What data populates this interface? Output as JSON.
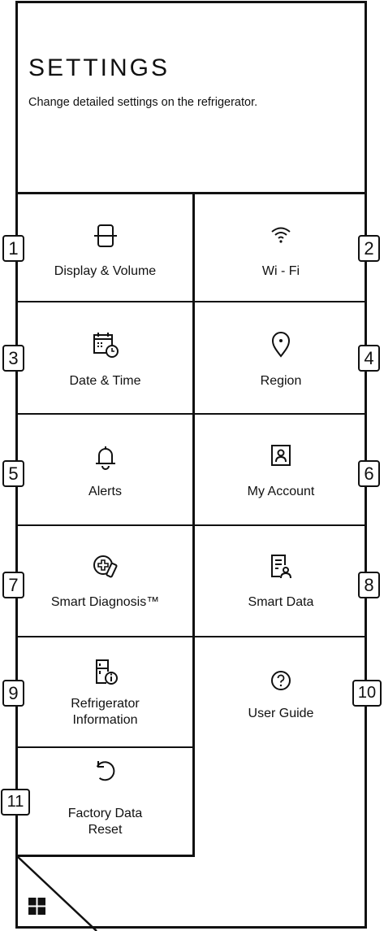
{
  "header": {
    "title": "SETTINGS",
    "subtitle": "Change detailed settings on the refrigerator."
  },
  "tiles": [
    {
      "label": "Display & Volume",
      "icon": "display-volume-icon",
      "badge": "1"
    },
    {
      "label": "Wi - Fi",
      "icon": "wifi-icon",
      "badge": "2"
    },
    {
      "label": "Date & Time",
      "icon": "calendar-clock-icon",
      "badge": "3"
    },
    {
      "label": "Region",
      "icon": "location-pin-icon",
      "badge": "4"
    },
    {
      "label": "Alerts",
      "icon": "bell-icon",
      "badge": "5"
    },
    {
      "label": "My Account",
      "icon": "account-icon",
      "badge": "6"
    },
    {
      "label": "Smart Diagnosis™",
      "icon": "smart-diagnosis-icon",
      "badge": "7"
    },
    {
      "label": "Smart Data",
      "icon": "smart-data-icon",
      "badge": "8"
    },
    {
      "label_line1": "Refrigerator",
      "label_line2": "Information",
      "icon": "refrigerator-info-icon",
      "badge": "9"
    },
    {
      "label": "User Guide",
      "icon": "question-icon",
      "badge": "10"
    },
    {
      "label_line1": "Factory Data",
      "label_line2": "Reset",
      "icon": "reset-icon",
      "badge": "11"
    }
  ],
  "footer": {
    "icon": "grid-apps-icon"
  }
}
